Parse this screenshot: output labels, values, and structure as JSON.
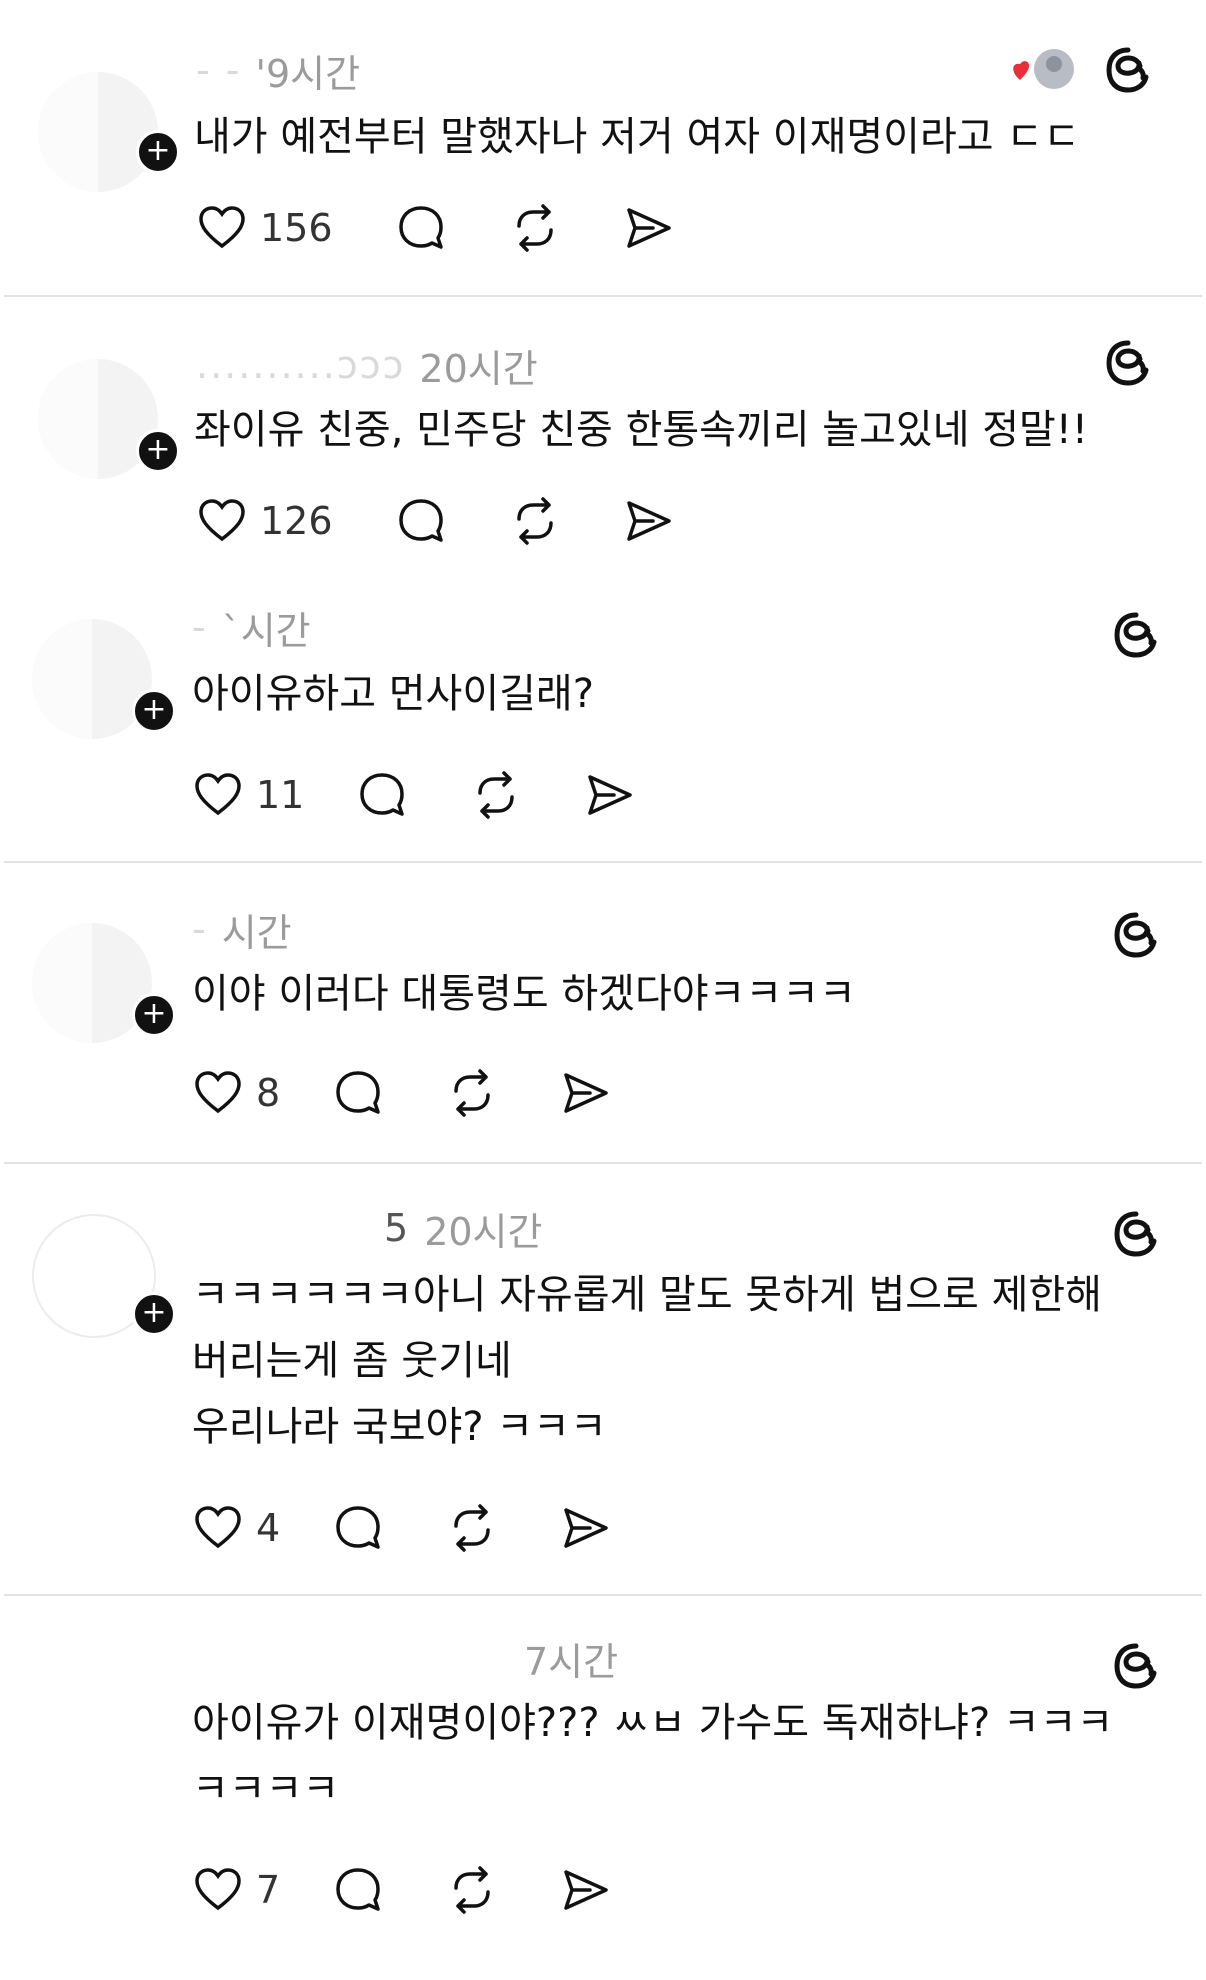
{
  "threads": [
    {
      "handle_fragment": "-  -",
      "time": "'9시간",
      "lines": [
        "내가 예전부터 말했자나 저거 여자 이재명이라고 ㄷㄷ"
      ],
      "likes": "156",
      "liked_by_friend": true
    },
    {
      "handle_fragment": "..........ɔɔɔ",
      "time": "20시간",
      "lines": [
        "좌이유 친중, 민주당 친중 한통속끼리 놀고있네 정말!!"
      ],
      "likes": "126"
    },
    {
      "handle_fragment": "-",
      "time": "`시간",
      "lines": [
        "아이유하고 먼사이길래?"
      ],
      "likes": "11"
    },
    {
      "handle_fragment": "-",
      "time": "시간",
      "lines": [
        "이야 이러다 대통령도 하겠다야ㅋㅋㅋㅋ"
      ],
      "likes": "8"
    },
    {
      "handle_fragment": "5",
      "time": "20시간",
      "lines": [
        "ㅋㅋㅋㅋㅋㅋ아니 자유롭게 말도 못하게 법으로 제한해",
        "버리는게 좀 웃기네",
        "우리나라 국보야? ㅋㅋㅋ"
      ],
      "likes": "4"
    },
    {
      "handle_fragment": "",
      "time": "7시간",
      "lines": [
        "아이유가 이재명이야??? ㅆㅂ 가수도 독재하냐? ㅋㅋㅋ",
        "ㅋㅋㅋㅋ"
      ],
      "likes": "7"
    }
  ],
  "icons": {
    "like": "heart-icon",
    "reply": "comment-icon",
    "repost": "repost-icon",
    "share": "send-icon",
    "brand": "threads-icon",
    "follow": "plus-icon"
  },
  "colors": {
    "text": "#111111",
    "meta": "#9b9b9b",
    "divider": "#e3e3e3",
    "like_badge": "#e8303a"
  }
}
